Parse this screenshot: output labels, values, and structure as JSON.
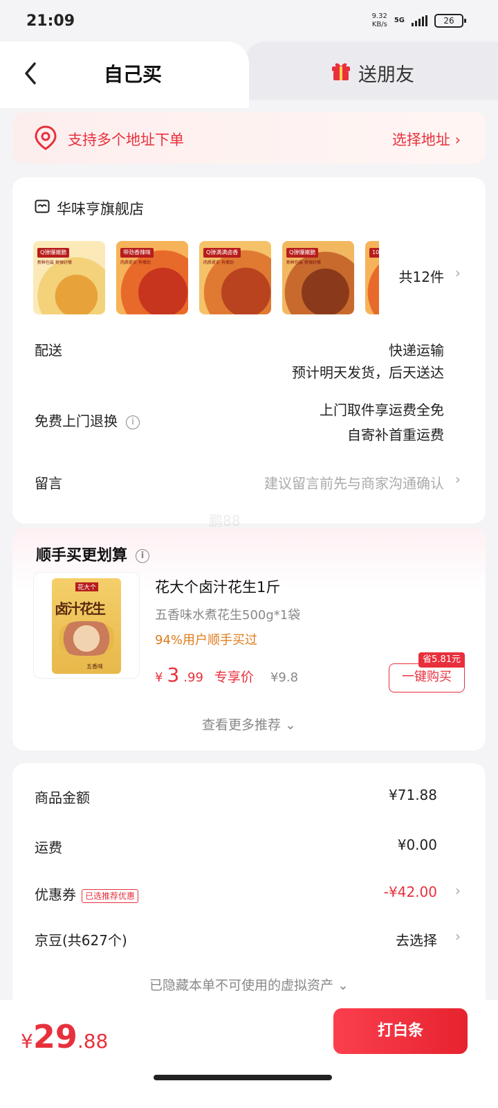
{
  "status_bar": {
    "time": "21:09",
    "net_speed_value": "9.32",
    "net_speed_unit": "KB/s",
    "network_type": "5G",
    "battery": "26"
  },
  "tabs": {
    "self": "自己买",
    "friend": "送朋友"
  },
  "address": {
    "text": "支持多个地址下单",
    "select": "选择地址 ›"
  },
  "order": {
    "store_name": "华味亨旗舰店",
    "thumbnails": [
      {
        "label": "Q弹爆嫩脆",
        "sub": "新鲜包装 爽弹好嚼"
      },
      {
        "label": "带劲香辣味",
        "sub": "肉质紧实 有嚼劲"
      },
      {
        "label": "Q弹满满卤香",
        "sub": "肉质紧实 有嚼劲"
      },
      {
        "label": "Q弹爆嫩脆",
        "sub": "新鲜包装 爽弹好嚼"
      },
      {
        "label": "10",
        "sub": ""
      }
    ],
    "item_count": "共12件",
    "delivery_label": "配送",
    "delivery_value_1": "快递运输",
    "delivery_value_2": "预计明天发货，后天送达",
    "return_label": "免费上门退换",
    "return_value_1": "上门取件享运费全免",
    "return_value_2": "自寄补首重运费",
    "message_label": "留言",
    "message_placeholder": "建议留言前先与商家沟通确认"
  },
  "watermark": "鹏88",
  "recommend": {
    "title": "顺手买更划算",
    "image_brand": "花大个",
    "image_title": "卤汁花生",
    "image_flavor": "五香味",
    "name": "花大个卤汁花生1斤",
    "desc": "五香味水煮花生500g*1袋",
    "users": "94%用户顺手买过",
    "price_symbol": "¥",
    "price_int": "3",
    "price_dec": ".99",
    "price_tag": "专享价",
    "original_price": "¥9.8",
    "save_badge": "省5.81元",
    "buy_button": "一键购买",
    "more": "查看更多推荐 ⌄"
  },
  "summary": {
    "goods_label": "商品金额",
    "goods_value": "¥71.88",
    "shipping_label": "运费",
    "shipping_value": "¥0.00",
    "coupon_label": "优惠券",
    "coupon_badge": "已选推荐优惠",
    "coupon_value": "-¥42.00",
    "jd_beans_label": "京豆(共627个)",
    "jd_beans_value": "去选择",
    "hidden_assets": "已隐藏本单不可使用的虚拟资产 ⌄"
  },
  "bottom": {
    "price_symbol": "¥",
    "price_int": "29",
    "price_dec": ".88",
    "pay_button": "打白条"
  },
  "colors": {
    "accent": "#e8303c",
    "orange": "#e07b1a"
  }
}
